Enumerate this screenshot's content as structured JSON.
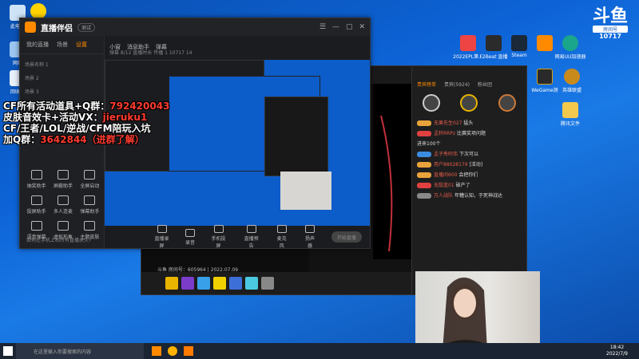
{
  "desktop": {
    "icons_left": [
      {
        "label": "此电脑"
      },
      {
        "label": "网络"
      },
      {
        "label": "回收站"
      }
    ],
    "icons_right": [
      {
        "label": "2022EPL第..."
      },
      {
        "label": "F2Beat 直播"
      },
      {
        "label": "Steam"
      },
      {
        "label": "网易UU加速器"
      },
      {
        "label": "WeGame测"
      },
      {
        "label": "英雄联盟"
      },
      {
        "label": "腾讯文件"
      }
    ]
  },
  "watermark": {
    "brand": "斗鱼",
    "tag": "房间号",
    "room": "10717"
  },
  "stream_tool": {
    "brand": "直播伴侣",
    "version": "测试",
    "left_tabs": [
      "我的直播",
      "场景",
      "设置"
    ],
    "scenes": [
      "场景名称 1",
      "场景 2",
      "场景 3"
    ],
    "tools": [
      "抽奖助手",
      "屏蔽助手",
      "全屏启动",
      "投屏助手",
      "多人连麦",
      "弹幕助手",
      "语音弹幕",
      "虚拟形象",
      "主题皮肤"
    ],
    "hint": "如何在手机上和所有直播永久?",
    "preview_top": [
      "小窗",
      "消息助手",
      "弹幕"
    ],
    "preview_sub": "弹幕 8/12 直播时长 传播 1 10717 14",
    "bottom": [
      "直播录屏",
      "录音",
      "手机投屏",
      "直播预告",
      "麦克风",
      "扬声器"
    ],
    "start_live": "开始直播"
  },
  "ad_overlay": {
    "line1_prefix": "CF所有活动道具+Q群：",
    "line1_num": "792420043",
    "line2_prefix": "皮肤音效卡+活动VX：",
    "line2_id": "jieruku1",
    "line3": "CF/王者/LOL/逆战/CFM陪玩入坑",
    "line4_prefix": "加Q群：",
    "line4_num": "3642844（进群了解）"
  },
  "douyu_room": {
    "room_info": "斗鱼 房间号：605964 | 2022.07.09",
    "chat_tabs": [
      "贵宾榜单",
      "贵宾(5924)",
      "粉丝团"
    ],
    "messages": [
      {
        "name": "无果先生027",
        "text": "猛头"
      },
      {
        "name": "孟轩RRPz",
        "text": "比赛奖项问题"
      },
      {
        "name": "",
        "text": "进来100个"
      },
      {
        "name": "孟子秀阿伟",
        "text": "下次可以"
      },
      {
        "name": "用户88028179",
        "text": "[活动]"
      },
      {
        "name": "直播间600",
        "text": "会把你们"
      },
      {
        "name": "无敌蓝01",
        "text": "破产了"
      },
      {
        "name": "万人战队",
        "text": "年糟认知，于死神战达"
      }
    ]
  },
  "taskbar": {
    "search_placeholder": "在这里输入你要搜索的内容",
    "time": "18:42",
    "date": "2022/7/9"
  }
}
